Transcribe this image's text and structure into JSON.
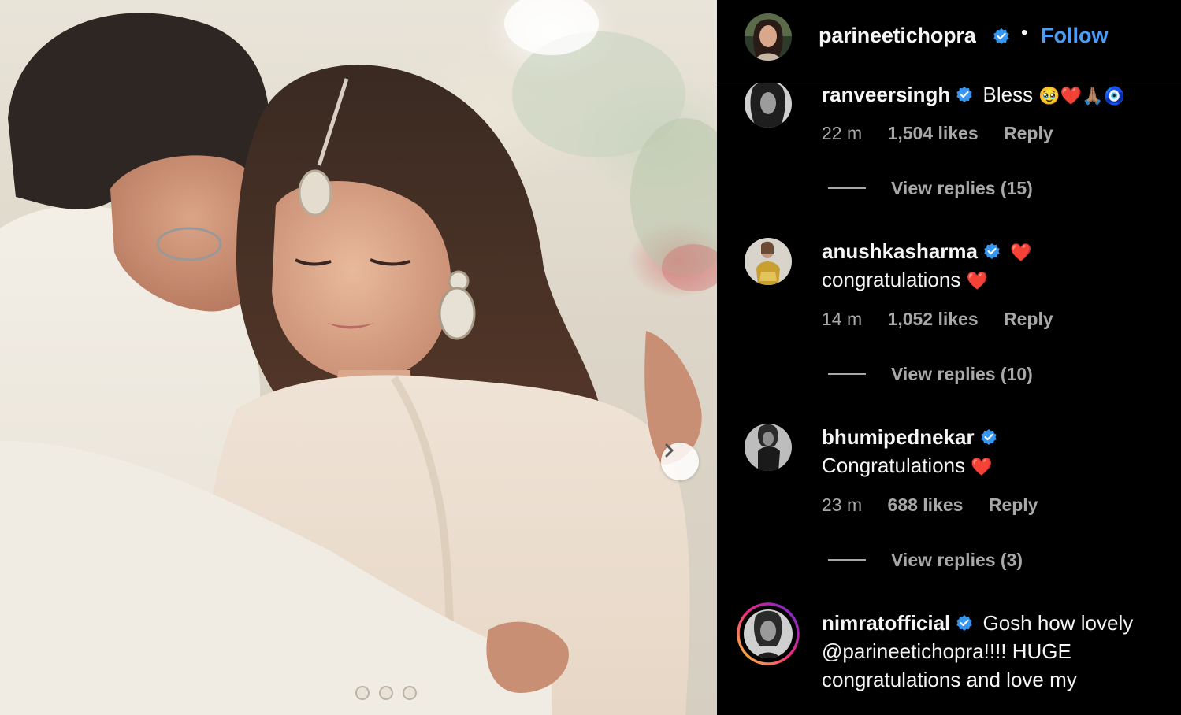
{
  "post": {
    "username": "parineetichopra",
    "follow_label": "Follow",
    "separator": "•"
  },
  "comments": [
    {
      "username": "ranveersingh",
      "text": "Bless",
      "emojis": "🥹❤️🙏🏽🧿",
      "time": "22 m",
      "likes": "1,504 likes",
      "reply_label": "Reply",
      "view_replies": "View replies (15)"
    },
    {
      "username": "anushkasharma",
      "text": "",
      "emojis": "❤️",
      "line2": "congratulations",
      "line2_emoji": "❤️",
      "time": "14 m",
      "likes": "1,052 likes",
      "reply_label": "Reply",
      "view_replies": "View replies (10)"
    },
    {
      "username": "bhumipednekar",
      "text": "",
      "line2": "Congratulations",
      "line2_emoji": "❤️",
      "time": "23 m",
      "likes": "688 likes",
      "reply_label": "Reply",
      "view_replies": "View replies (3)"
    },
    {
      "username": "nimratofficial",
      "text": "Gosh how lovely",
      "line2": "@parineetichopra!!!! HUGE",
      "line3": "congratulations and love my"
    }
  ],
  "colors": {
    "background": "#000000",
    "follow": "#4a9df8",
    "verified": "#3797f0",
    "meta_text": "#a8a8a8",
    "story_ring_start": "#f9ce34",
    "story_ring_mid": "#ee2a7b",
    "story_ring_end": "#6228d7"
  },
  "icons": {
    "verified": "verified-badge-icon",
    "next": "chevron-right-icon"
  }
}
